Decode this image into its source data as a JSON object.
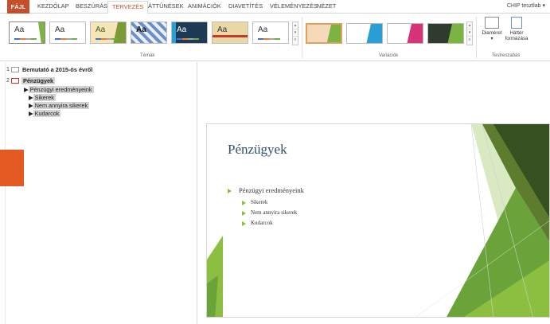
{
  "ribbon": {
    "tabs": {
      "file": "FÁJL",
      "home": "KEZDŐLAP",
      "insert": "BESZÚRÁS",
      "design": "TERVEZÉS",
      "transitions": "ÁTTŰNÉSEK",
      "animations": "ANIMÁCIÓK",
      "slideshow": "DIAVETÍTÉS",
      "review": "VÉLEMÉNYEZÉS",
      "view": "NÉZET"
    },
    "user": "CHIP tesztlab",
    "active_tab": "TERVEZÉS",
    "accent_color": "#c74e2d",
    "themes_label": "Témák",
    "variants_label": "Variációk",
    "customize_label": "Testreszabás",
    "theme_sample_text": "Aa",
    "slide_size_label": "Diaméret",
    "format_background_label_1": "Háttér",
    "format_background_label_2": "formázása"
  },
  "outline": {
    "slides": [
      {
        "number": "1",
        "title": "Bemutató a 2015-ös évről"
      },
      {
        "number": "2",
        "title": "Pénzügyek"
      }
    ],
    "bullets": {
      "level1": "Pénzügyi eredményeink",
      "level2": [
        "Sikerek",
        "Nem annyira sikerek",
        "Kudarcok"
      ]
    }
  },
  "slide": {
    "title": "Pénzügyek",
    "bullet_main": "Pénzügyi eredményeink",
    "sub_bullets": [
      "Sikerek",
      "Nem annyira sikerek",
      "Kudarcok"
    ],
    "accent_color": "#8cbf3f"
  }
}
